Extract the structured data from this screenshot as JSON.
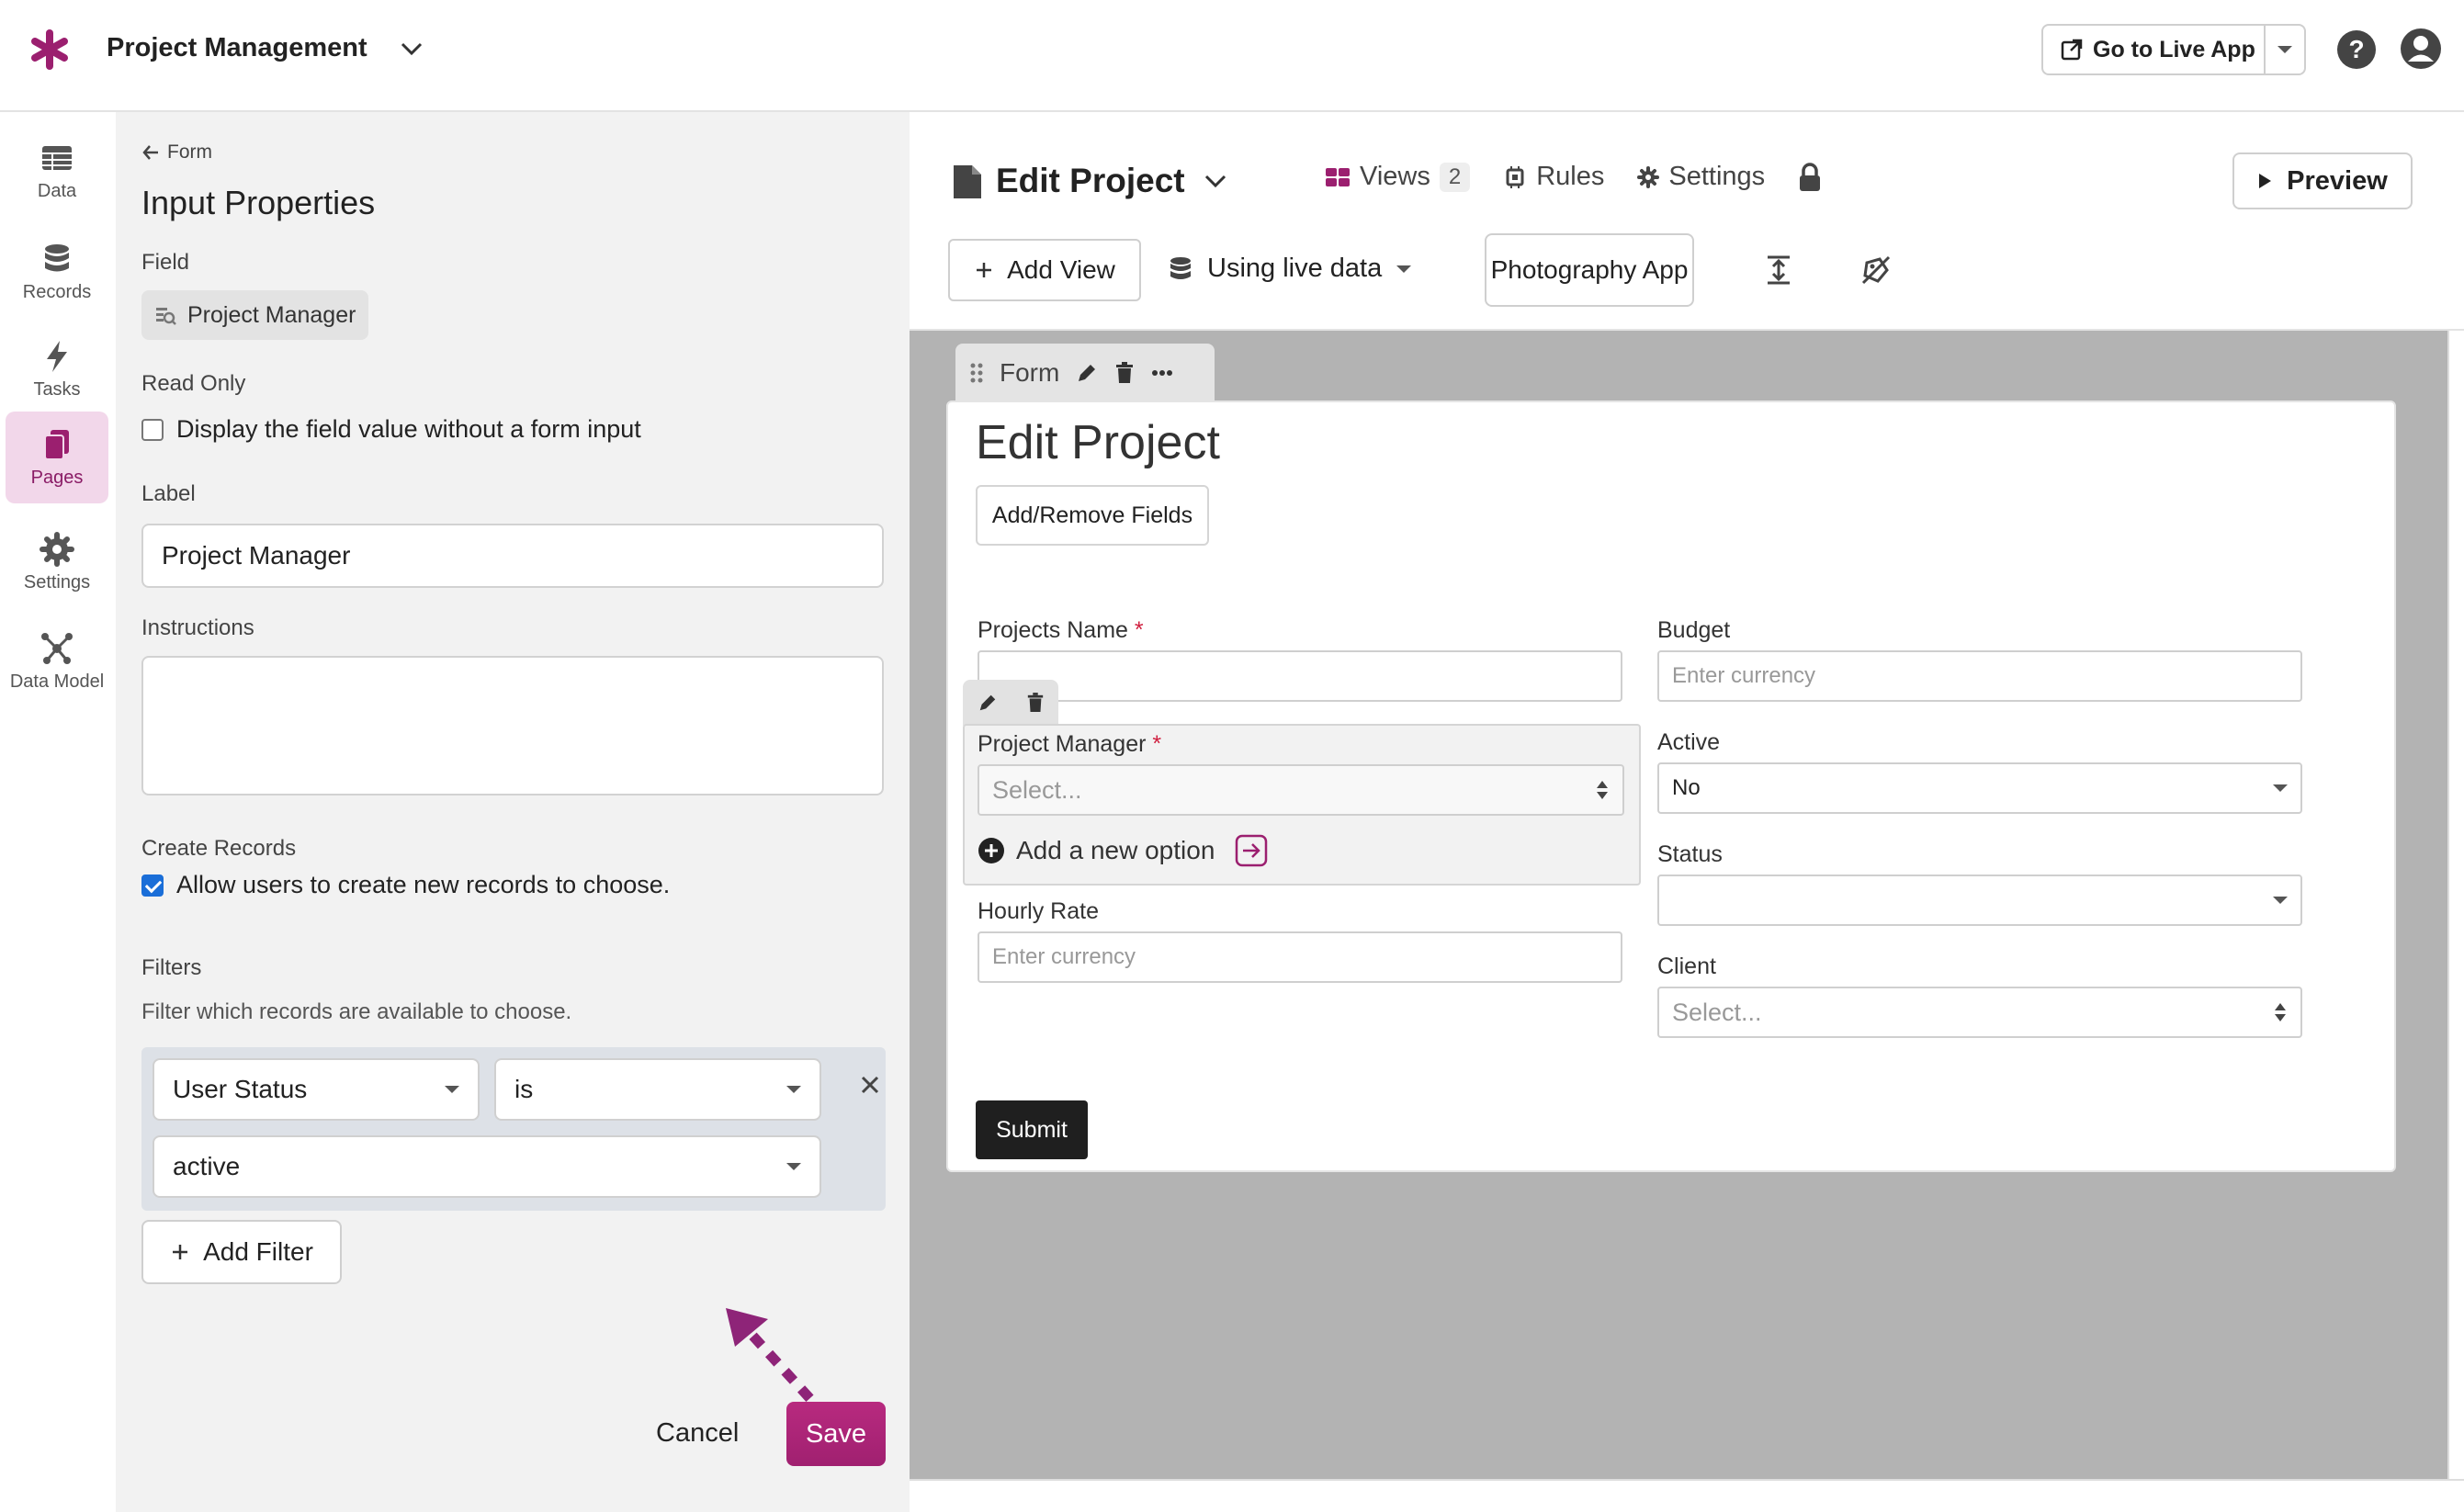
{
  "header": {
    "app_title": "Project Management",
    "live_app_label": "Go to Live App",
    "accent": "#9b1f6f"
  },
  "nav": {
    "items": [
      {
        "label": "Data",
        "icon": "table-icon"
      },
      {
        "label": "Records",
        "icon": "database-icon"
      },
      {
        "label": "Tasks",
        "icon": "bolt-icon"
      },
      {
        "label": "Pages",
        "icon": "pages-icon",
        "active": true
      },
      {
        "label": "Settings",
        "icon": "gear-icon"
      },
      {
        "label": "Data Model",
        "icon": "graph-icon"
      }
    ]
  },
  "props": {
    "back_label": "Form",
    "title": "Input Properties",
    "field_label": "Field",
    "field_value": "Project Manager",
    "readonly_label": "Read Only",
    "readonly_checkbox": "Display the field value without a form input",
    "readonly_checked": false,
    "label_label": "Label",
    "label_value": "Project Manager",
    "instructions_label": "Instructions",
    "instructions_value": "",
    "create_label": "Create Records",
    "create_checkbox": "Allow users to create new records to choose.",
    "create_checked": true,
    "filters_label": "Filters",
    "filters_helper": "Filter which records are available to choose.",
    "filter": {
      "field": "User Status",
      "operator": "is",
      "value": "active"
    },
    "add_filter": "Add Filter",
    "cancel": "Cancel",
    "save": "Save"
  },
  "editor": {
    "title": "Edit Project",
    "views_label": "Views",
    "views_count": "2",
    "rules_label": "Rules",
    "settings_label": "Settings",
    "preview_label": "Preview",
    "add_view": "Add View",
    "live_data": "Using live data",
    "app_name": "Photography App"
  },
  "form": {
    "tab_label": "Form",
    "title": "Edit Project",
    "add_remove": "Add/Remove Fields",
    "projects_name": "Projects Name",
    "budget": "Budget",
    "budget_placeholder": "Enter currency",
    "project_manager": "Project Manager",
    "pm_placeholder": "Select...",
    "add_option": "Add a new option",
    "active": "Active",
    "active_value": "No",
    "status": "Status",
    "hourly_rate": "Hourly Rate",
    "hourly_placeholder": "Enter currency",
    "client": "Client",
    "client_placeholder": "Select...",
    "submit": "Submit",
    "required_mark": "*"
  }
}
